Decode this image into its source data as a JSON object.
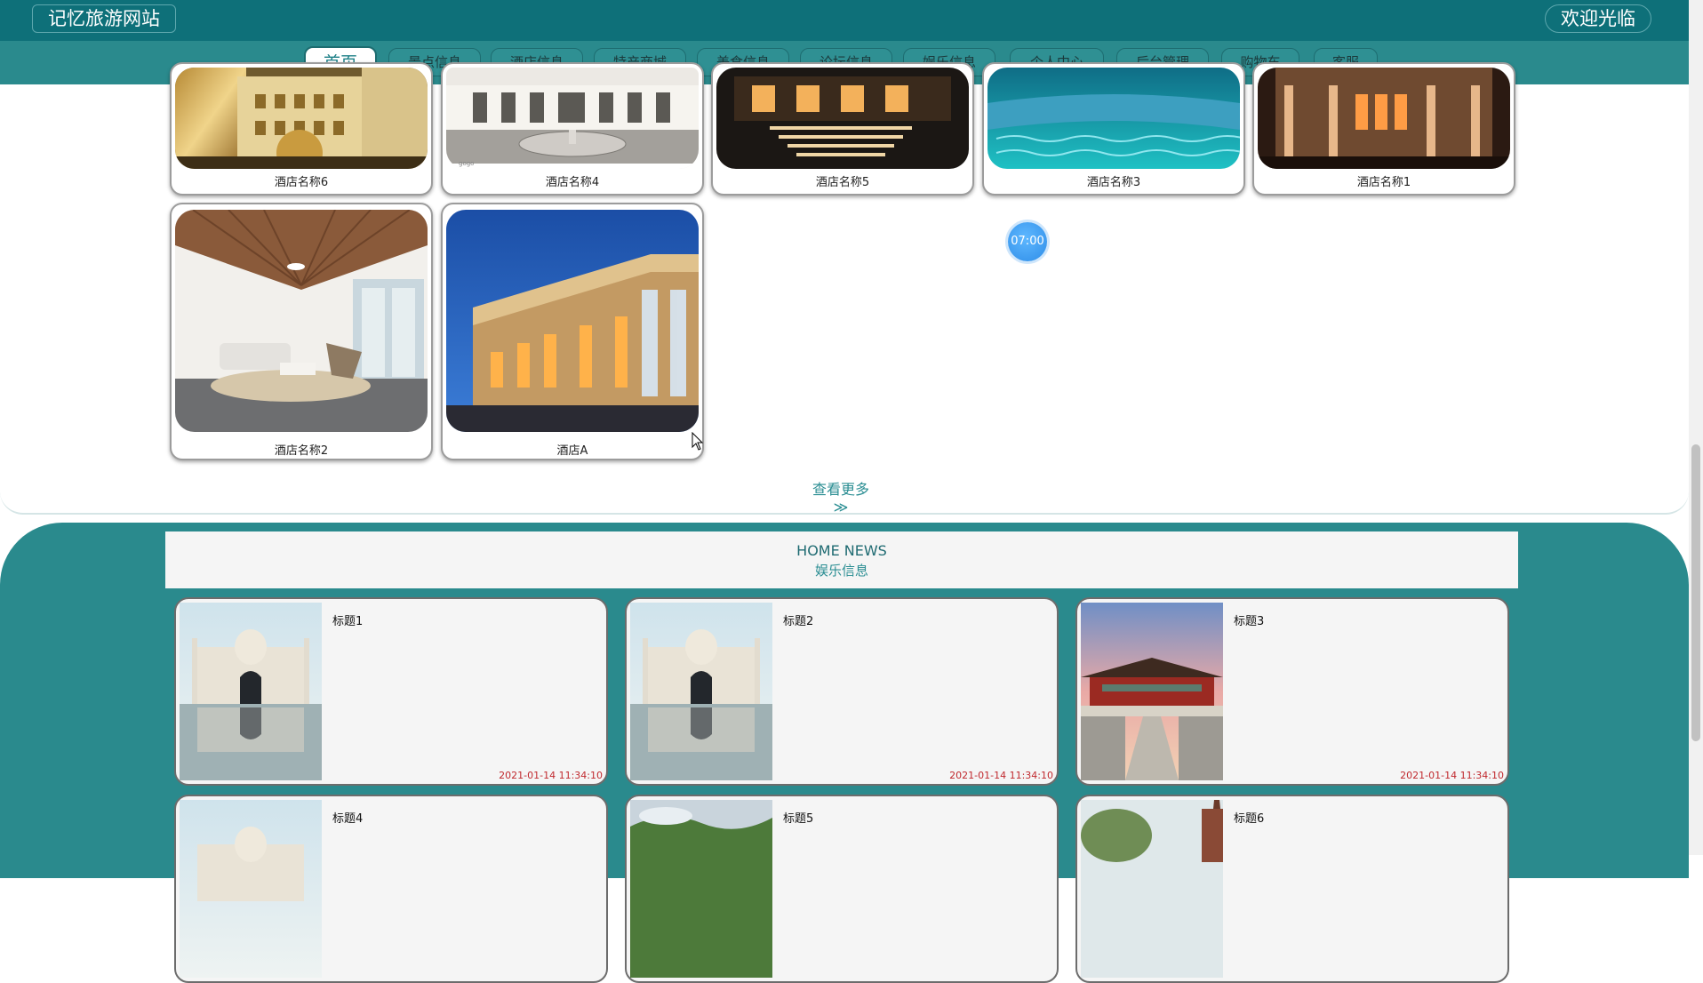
{
  "header": {
    "site_name": "记忆旅游网站",
    "welcome": "欢迎光临"
  },
  "nav": {
    "items": [
      {
        "label": "首页",
        "active": true
      },
      {
        "label": "景点信息"
      },
      {
        "label": "酒店信息"
      },
      {
        "label": "特产商城"
      },
      {
        "label": "美食信息"
      },
      {
        "label": "论坛信息"
      },
      {
        "label": "娱乐信息"
      },
      {
        "label": "个人中心"
      },
      {
        "label": "后台管理"
      },
      {
        "label": "购物车"
      },
      {
        "label": "客服"
      }
    ]
  },
  "hotels": {
    "items": [
      {
        "name": "酒店名称6"
      },
      {
        "name": "酒店名称4"
      },
      {
        "name": "酒店名称5"
      },
      {
        "name": "酒店名称3"
      },
      {
        "name": "酒店名称1"
      },
      {
        "name": "酒店名称2"
      },
      {
        "name": "酒店A"
      }
    ],
    "more_label": "查看更多≫",
    "photo_watermark": "gogo"
  },
  "timer": "07:00",
  "news": {
    "heading_en": "HOME NEWS",
    "heading_cn": "娱乐信息",
    "items": [
      {
        "title": "标题1",
        "date": "2021-01-14 11:34:10"
      },
      {
        "title": "标题2",
        "date": "2021-01-14 11:34:10"
      },
      {
        "title": "标题3",
        "date": "2021-01-14 11:34:10"
      },
      {
        "title": "标题4",
        "date": ""
      },
      {
        "title": "标题5",
        "date": ""
      },
      {
        "title": "标题6",
        "date": ""
      }
    ]
  },
  "colors": {
    "primary": "#0e7079",
    "nav_bg": "#2a8a8d",
    "accent": "#2b8e93",
    "date": "#c0282d"
  }
}
